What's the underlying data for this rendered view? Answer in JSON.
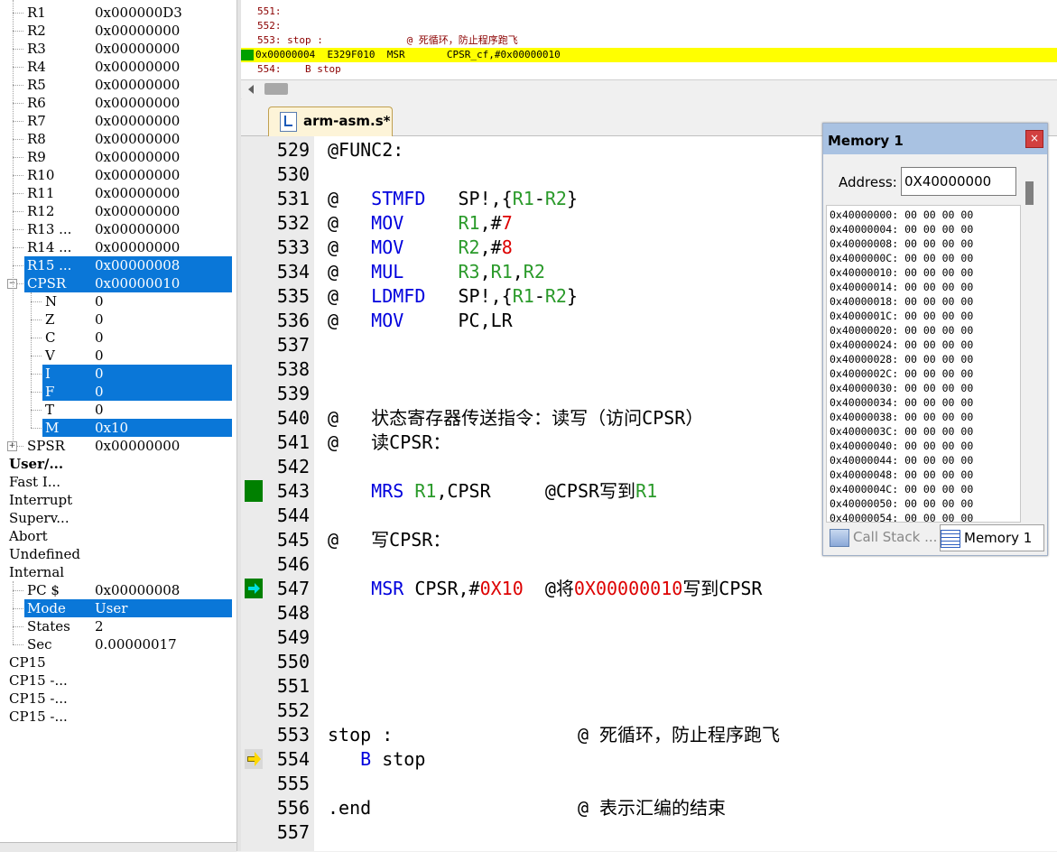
{
  "registers": {
    "rows": [
      {
        "name": "R1",
        "value": "0x000000D3",
        "indent": 1,
        "selected": false
      },
      {
        "name": "R2",
        "value": "0x00000000",
        "indent": 1,
        "selected": false
      },
      {
        "name": "R3",
        "value": "0x00000000",
        "indent": 1,
        "selected": false
      },
      {
        "name": "R4",
        "value": "0x00000000",
        "indent": 1,
        "selected": false
      },
      {
        "name": "R5",
        "value": "0x00000000",
        "indent": 1,
        "selected": false
      },
      {
        "name": "R6",
        "value": "0x00000000",
        "indent": 1,
        "selected": false
      },
      {
        "name": "R7",
        "value": "0x00000000",
        "indent": 1,
        "selected": false
      },
      {
        "name": "R8",
        "value": "0x00000000",
        "indent": 1,
        "selected": false
      },
      {
        "name": "R9",
        "value": "0x00000000",
        "indent": 1,
        "selected": false
      },
      {
        "name": "R10",
        "value": "0x00000000",
        "indent": 1,
        "selected": false
      },
      {
        "name": "R11",
        "value": "0x00000000",
        "indent": 1,
        "selected": false
      },
      {
        "name": "R12",
        "value": "0x00000000",
        "indent": 1,
        "selected": false
      },
      {
        "name": "R13 ...",
        "value": "0x00000000",
        "indent": 1,
        "selected": false
      },
      {
        "name": "R14 ...",
        "value": "0x00000000",
        "indent": 1,
        "selected": false
      },
      {
        "name": "R15 ...",
        "value": "0x00000008",
        "indent": 1,
        "selected": true
      },
      {
        "name": "CPSR",
        "value": "0x00000010",
        "indent": 1,
        "selected": true,
        "expander": "minus"
      },
      {
        "name": "N",
        "value": "0",
        "indent": 2,
        "selected": false
      },
      {
        "name": "Z",
        "value": "0",
        "indent": 2,
        "selected": false
      },
      {
        "name": "C",
        "value": "0",
        "indent": 2,
        "selected": false
      },
      {
        "name": "V",
        "value": "0",
        "indent": 2,
        "selected": false
      },
      {
        "name": "I",
        "value": "0",
        "indent": 2,
        "selected": true
      },
      {
        "name": "F",
        "value": "0",
        "indent": 2,
        "selected": true
      },
      {
        "name": "T",
        "value": "0",
        "indent": 2,
        "selected": false
      },
      {
        "name": "M",
        "value": "0x10",
        "indent": 2,
        "selected": true
      },
      {
        "name": "SPSR",
        "value": "0x00000000",
        "indent": 1,
        "selected": false,
        "expander": "plus"
      },
      {
        "name": "User/...",
        "value": "",
        "indent": 0,
        "selected": false,
        "bold": true
      },
      {
        "name": "Fast I...",
        "value": "",
        "indent": 0,
        "selected": false
      },
      {
        "name": "Interrupt",
        "value": "",
        "indent": 0,
        "selected": false
      },
      {
        "name": "Superv...",
        "value": "",
        "indent": 0,
        "selected": false
      },
      {
        "name": "Abort",
        "value": "",
        "indent": 0,
        "selected": false
      },
      {
        "name": "Undefined",
        "value": "",
        "indent": 0,
        "selected": false
      },
      {
        "name": "Internal",
        "value": "",
        "indent": 0,
        "selected": false
      },
      {
        "name": "PC  $",
        "value": "0x00000008",
        "indent": 1,
        "selected": false
      },
      {
        "name": "Mode",
        "value": "User",
        "indent": 1,
        "selected": true
      },
      {
        "name": "States",
        "value": "2",
        "indent": 1,
        "selected": false
      },
      {
        "name": "Sec",
        "value": "0.00000017",
        "indent": 1,
        "selected": false
      },
      {
        "name": "CP15",
        "value": "",
        "indent": 0,
        "selected": false
      },
      {
        "name": "CP15 -...",
        "value": "",
        "indent": 0,
        "selected": false
      },
      {
        "name": "CP15 -...",
        "value": "",
        "indent": 0,
        "selected": false
      },
      {
        "name": "CP15 -...",
        "value": "",
        "indent": 0,
        "selected": false
      }
    ]
  },
  "disassembly": {
    "lines": [
      {
        "text": "551:",
        "current": false
      },
      {
        "text": "552:",
        "current": false
      },
      {
        "text": "553: stop :              @ 死循环，防止程序跑飞",
        "current": false
      },
      {
        "text": "0x00000004  E329F010  MSR       CPSR_cf,#0x00000010",
        "current": true
      },
      {
        "text": "554:    B stop",
        "current": false
      }
    ]
  },
  "editor": {
    "tab_label": "arm-asm.s*",
    "lines": [
      {
        "num": "529",
        "tokens": [
          {
            "t": "@FUNC2:",
            "c": ""
          }
        ]
      },
      {
        "num": "530",
        "tokens": []
      },
      {
        "num": "531",
        "tokens": [
          {
            "t": "@   ",
            "c": ""
          },
          {
            "t": "STMFD",
            "c": "k"
          },
          {
            "t": "   SP!,{",
            "c": ""
          },
          {
            "t": "R1",
            "c": "r"
          },
          {
            "t": "-",
            "c": ""
          },
          {
            "t": "R2",
            "c": "r"
          },
          {
            "t": "}",
            "c": ""
          }
        ]
      },
      {
        "num": "532",
        "tokens": [
          {
            "t": "@   ",
            "c": ""
          },
          {
            "t": "MOV",
            "c": "k"
          },
          {
            "t": "     ",
            "c": ""
          },
          {
            "t": "R1",
            "c": "r"
          },
          {
            "t": ",#",
            "c": ""
          },
          {
            "t": "7",
            "c": "n"
          }
        ]
      },
      {
        "num": "533",
        "tokens": [
          {
            "t": "@   ",
            "c": ""
          },
          {
            "t": "MOV",
            "c": "k"
          },
          {
            "t": "     ",
            "c": ""
          },
          {
            "t": "R2",
            "c": "r"
          },
          {
            "t": ",#",
            "c": ""
          },
          {
            "t": "8",
            "c": "n"
          }
        ]
      },
      {
        "num": "534",
        "tokens": [
          {
            "t": "@   ",
            "c": ""
          },
          {
            "t": "MUL",
            "c": "k"
          },
          {
            "t": "     ",
            "c": ""
          },
          {
            "t": "R3",
            "c": "r"
          },
          {
            "t": ",",
            "c": ""
          },
          {
            "t": "R1",
            "c": "r"
          },
          {
            "t": ",",
            "c": ""
          },
          {
            "t": "R2",
            "c": "r"
          }
        ]
      },
      {
        "num": "535",
        "tokens": [
          {
            "t": "@   ",
            "c": ""
          },
          {
            "t": "LDMFD",
            "c": "k"
          },
          {
            "t": "   SP!,{",
            "c": ""
          },
          {
            "t": "R1",
            "c": "r"
          },
          {
            "t": "-",
            "c": ""
          },
          {
            "t": "R2",
            "c": "r"
          },
          {
            "t": "}",
            "c": ""
          }
        ]
      },
      {
        "num": "536",
        "tokens": [
          {
            "t": "@   ",
            "c": ""
          },
          {
            "t": "MOV",
            "c": "k"
          },
          {
            "t": "     PC,LR",
            "c": ""
          }
        ]
      },
      {
        "num": "537",
        "tokens": []
      },
      {
        "num": "538",
        "tokens": []
      },
      {
        "num": "539",
        "tokens": []
      },
      {
        "num": "540",
        "tokens": [
          {
            "t": "@   状态寄存器传送指令：读写（访问CPSR）",
            "c": ""
          }
        ]
      },
      {
        "num": "541",
        "tokens": [
          {
            "t": "@   读CPSR：",
            "c": ""
          }
        ]
      },
      {
        "num": "542",
        "tokens": []
      },
      {
        "num": "543",
        "tokens": [
          {
            "t": "    ",
            "c": ""
          },
          {
            "t": "MRS",
            "c": "k"
          },
          {
            "t": " ",
            "c": ""
          },
          {
            "t": "R1",
            "c": "r"
          },
          {
            "t": ",CPSR     @CPSR写到",
            "c": ""
          },
          {
            "t": "R1",
            "c": "r"
          }
        ],
        "marker": "breakpoint"
      },
      {
        "num": "544",
        "tokens": []
      },
      {
        "num": "545",
        "tokens": [
          {
            "t": "@   写CPSR：",
            "c": ""
          }
        ]
      },
      {
        "num": "546",
        "tokens": []
      },
      {
        "num": "547",
        "tokens": [
          {
            "t": "    ",
            "c": ""
          },
          {
            "t": "MSR",
            "c": "k"
          },
          {
            "t": " CPSR,#",
            "c": ""
          },
          {
            "t": "0X10",
            "c": "n"
          },
          {
            "t": "  @将",
            "c": ""
          },
          {
            "t": "0X00000010",
            "c": "n"
          },
          {
            "t": "写到CPSR",
            "c": ""
          }
        ],
        "marker": "pc"
      },
      {
        "num": "548",
        "tokens": []
      },
      {
        "num": "549",
        "tokens": []
      },
      {
        "num": "550",
        "tokens": []
      },
      {
        "num": "551",
        "tokens": []
      },
      {
        "num": "552",
        "tokens": []
      },
      {
        "num": "553",
        "tokens": [
          {
            "t": "stop :                 @ 死循环，防止程序跑飞",
            "c": ""
          }
        ]
      },
      {
        "num": "554",
        "tokens": [
          {
            "t": "   ",
            "c": ""
          },
          {
            "t": "B",
            "c": "k"
          },
          {
            "t": " stop",
            "c": ""
          }
        ],
        "marker": "cursor"
      },
      {
        "num": "555",
        "tokens": []
      },
      {
        "num": "556",
        "tokens": [
          {
            "t": ".end                   @ 表示汇编的结束",
            "c": ""
          }
        ]
      },
      {
        "num": "557",
        "tokens": []
      }
    ]
  },
  "memory": {
    "title": "Memory 1",
    "close_label": "×",
    "address_label": "Address:",
    "address_value": "0X40000000",
    "rows": [
      "0x40000000: 00 00 00 00",
      "0x40000004: 00 00 00 00",
      "0x40000008: 00 00 00 00",
      "0x4000000C: 00 00 00 00",
      "0x40000010: 00 00 00 00",
      "0x40000014: 00 00 00 00",
      "0x40000018: 00 00 00 00",
      "0x4000001C: 00 00 00 00",
      "0x40000020: 00 00 00 00",
      "0x40000024: 00 00 00 00",
      "0x40000028: 00 00 00 00",
      "0x4000002C: 00 00 00 00",
      "0x40000030: 00 00 00 00",
      "0x40000034: 00 00 00 00",
      "0x40000038: 00 00 00 00",
      "0x4000003C: 00 00 00 00",
      "0x40000040: 00 00 00 00",
      "0x40000044: 00 00 00 00",
      "0x40000048: 00 00 00 00",
      "0x4000004C: 00 00 00 00",
      "0x40000050: 00 00 00 00",
      "0x40000054: 00 00 00 00"
    ],
    "tabs": {
      "call_stack": "Call Stack ...",
      "memory1": "Memory 1"
    }
  },
  "colors": {
    "selection": "#0a77d8",
    "current_line": "#ffff00",
    "keyword": "#0000dd",
    "register": "#2a9a2a",
    "number": "#dd0000",
    "breakpoint": "#008000"
  }
}
